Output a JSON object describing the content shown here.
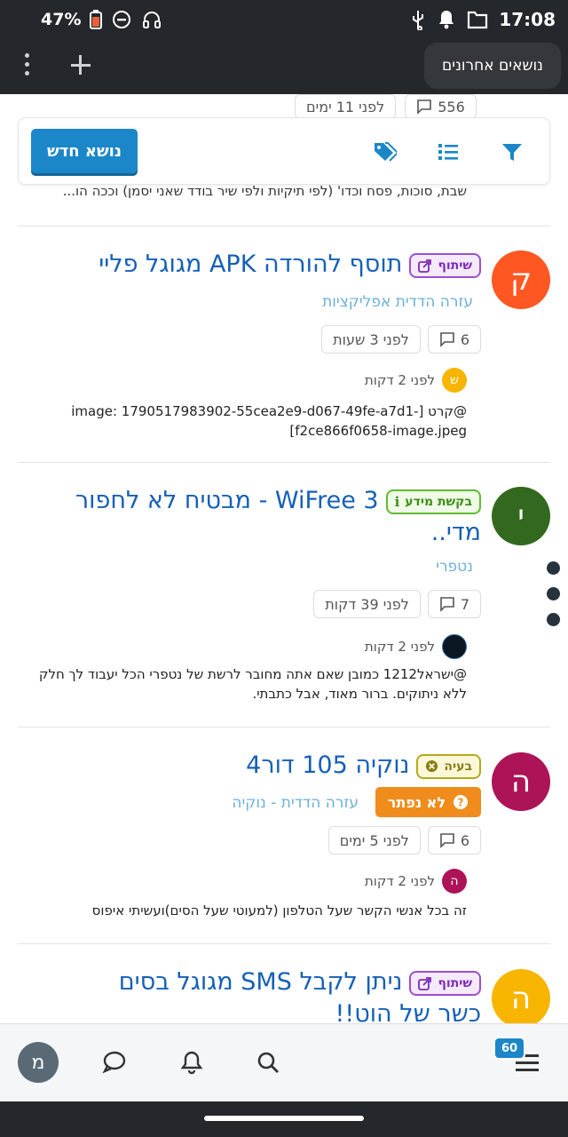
{
  "status": {
    "battery": "47%",
    "time": "17:08"
  },
  "appbar": {
    "recent_label": "נושאים אחרונים"
  },
  "prev": {
    "time": "לפני 11 ימים",
    "replies": "556"
  },
  "toolbar": {
    "new_topic": "נושא חדש"
  },
  "excerpt_top": "שבת, סוכות, פסח וכדו' (לפי תיקיות ולפי שיר בודד שאני יסמן) וככה הו...",
  "topics": [
    {
      "avatar_letter": "ק",
      "avatar_color": "#ff5722",
      "title": "תוסף להורדה APK מגוגל פליי",
      "badge": "שיתוף",
      "category": "עזרה הדדית אפליקציות",
      "replies": "6",
      "time": "לפני 3 שעות",
      "reply_avatar": "ש",
      "reply_avatar_color": "#f7b500",
      "reply_time": "לפני 2 דקות",
      "reply_text": "@קרט [-image: 1790517983902-55cea2e9-d067-49fe-a7d1 f2ce866f0658-image.jpeg]"
    },
    {
      "avatar_letter": "י",
      "avatar_color": "#33691e",
      "title": "WiFree 3 - מבטיח לא לחפור מדי..",
      "badge": "בקשת מידע",
      "category": "נטפרי",
      "replies": "7",
      "time": "לפני 39 דקות",
      "reply_time": "לפני 2 דקות",
      "reply_text": "@ישראל1212 כמובן שאם אתה מחובר לרשת של נטפרי הכל יעבוד לך חלק ללא ניתוקים. ברור מאוד, אבל כתבתי."
    },
    {
      "avatar_letter": "ה",
      "avatar_color": "#ad1457",
      "title": "נוקיה 105 דור4",
      "badge": "בעיה",
      "unsolved": "לא נפתר",
      "category": "עזרה הדדית - נוקיה",
      "replies": "6",
      "time": "לפני 5 ימים",
      "reply_avatar": "ה",
      "reply_avatar_color": "#ad1457",
      "reply_time": "לפני 2 דקות",
      "reply_text": "זה בכל אנשי הקשר שעל הטלפון (למעוטי שעל הסים)ועשיתי איפוס"
    },
    {
      "avatar_letter": "ה",
      "avatar_color": "#f7b500",
      "title": "ניתן לקבל SMS מגוגל בסים כשר של הוט!!",
      "badge": "שיתוף"
    }
  ],
  "bottomnav": {
    "badge_count": "60",
    "user_letter": "מ"
  }
}
